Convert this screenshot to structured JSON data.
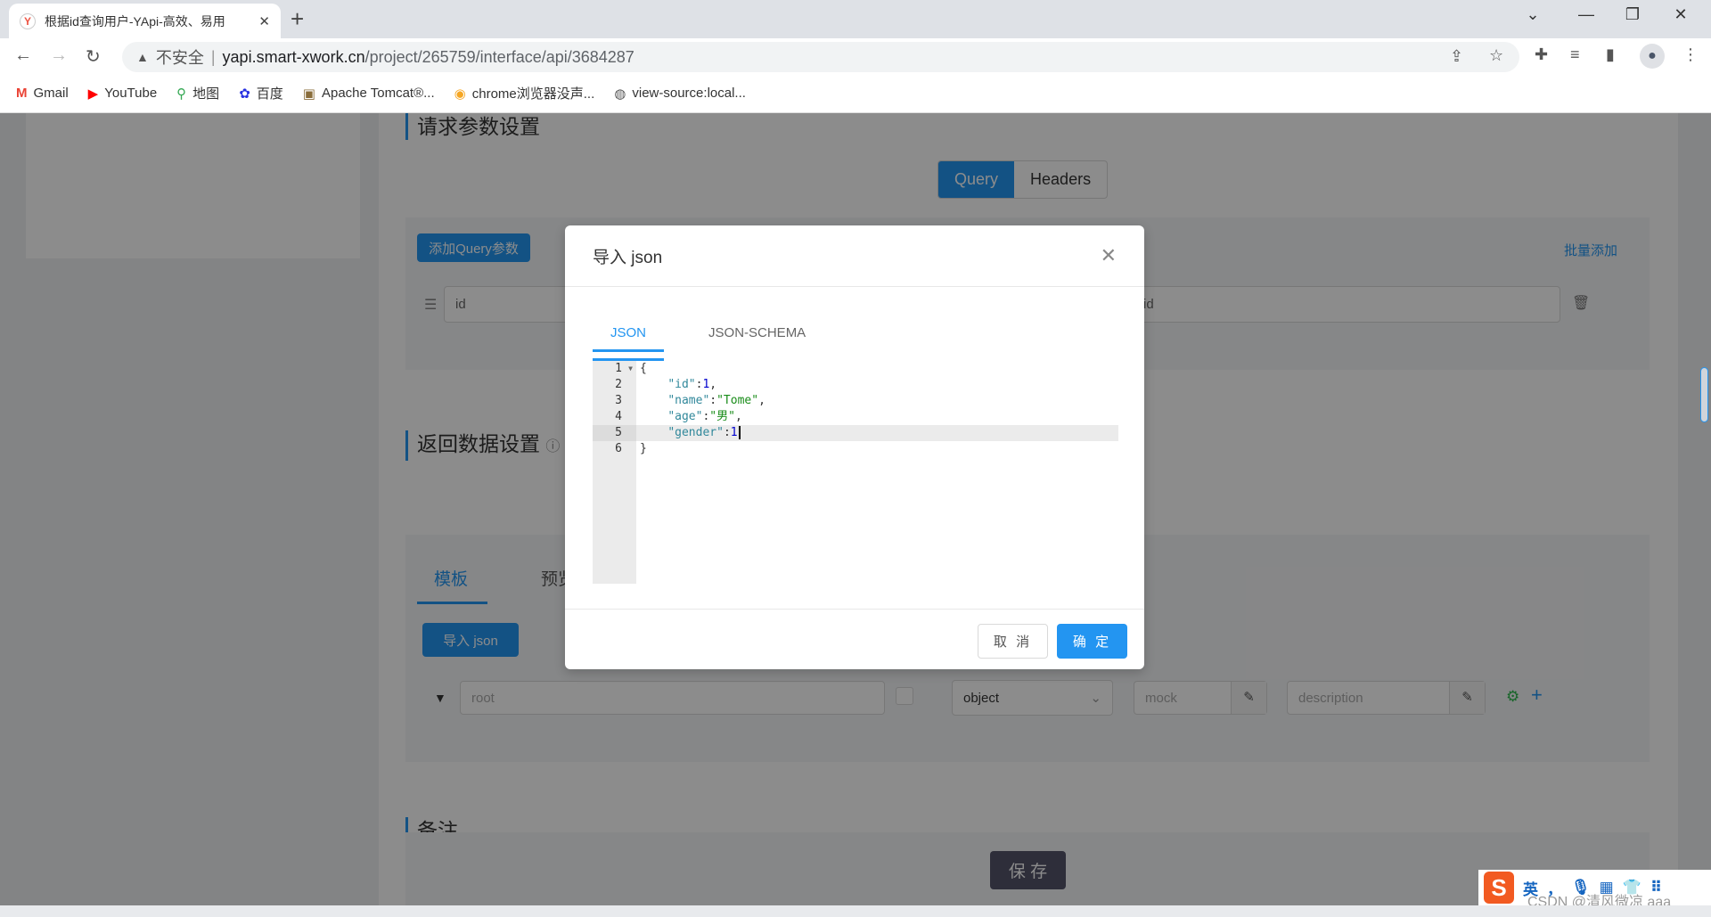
{
  "browser": {
    "tab_title": "根据id查询用户-YApi-高效、易用",
    "url_warning": "不安全",
    "url_host": "yapi.smart-xwork.cn",
    "url_path": "/project/265759/interface/api/3684287",
    "bookmarks": [
      {
        "label": "Gmail",
        "icon": "gmail-icon",
        "color": "#ea4335"
      },
      {
        "label": "YouTube",
        "icon": "youtube-icon",
        "color": "#ff0000"
      },
      {
        "label": "地图",
        "icon": "maps-icon",
        "color": "#34a853"
      },
      {
        "label": "百度",
        "icon": "baidu-icon",
        "color": "#2932e1"
      },
      {
        "label": "Apache Tomcat®...",
        "icon": "tomcat-icon",
        "color": "#8a6d3b"
      },
      {
        "label": "chrome浏览器没声...",
        "icon": "chrome-help-icon",
        "color": "#f5a623"
      },
      {
        "label": "view-source:local...",
        "icon": "globe-icon",
        "color": "#555"
      }
    ]
  },
  "page": {
    "request_section_title": "请求参数设置",
    "seg_tabs": [
      "Query",
      "Headers"
    ],
    "add_query_button": "添加Query参数",
    "bulk_add_link": "批量添加",
    "query_row": {
      "name": "id",
      "desc": "id"
    },
    "response_section_title": "返回数据设置",
    "response_tabs": [
      "模板",
      "预览"
    ],
    "import_json_button": "导入 json",
    "schema_row": {
      "name_placeholder": "root",
      "type": "object",
      "mock_placeholder": "mock",
      "desc_placeholder": "description"
    },
    "remark_section_title": "备注",
    "save_button": "保 存"
  },
  "modal": {
    "title": "导入 json",
    "tabs": [
      "JSON",
      "JSON-SCHEMA"
    ],
    "active_tab": "JSON",
    "code_lines": [
      [
        [
          "p",
          "{"
        ]
      ],
      [
        [
          "p",
          "    "
        ],
        [
          "k",
          "\"id\""
        ],
        [
          "p",
          ":"
        ],
        [
          "n",
          "1"
        ],
        [
          "p",
          ","
        ]
      ],
      [
        [
          "p",
          "    "
        ],
        [
          "k",
          "\"name\""
        ],
        [
          "p",
          ":"
        ],
        [
          "s",
          "\"Tome\""
        ],
        [
          "p",
          ","
        ]
      ],
      [
        [
          "p",
          "    "
        ],
        [
          "k",
          "\"age\""
        ],
        [
          "p",
          ":"
        ],
        [
          "s",
          "\"男\""
        ],
        [
          "p",
          ","
        ]
      ],
      [
        [
          "p",
          "    "
        ],
        [
          "k",
          "\"gender\""
        ],
        [
          "p",
          ":"
        ],
        [
          "n",
          "1"
        ]
      ],
      [
        [
          "p",
          "}"
        ]
      ]
    ],
    "line_numbers": [
      "1",
      "2",
      "3",
      "4",
      "5",
      "6"
    ],
    "active_line": 5,
    "cancel_button": "取 消",
    "ok_button": "确 定"
  },
  "ime": {
    "lang": "英",
    "punct": "，"
  },
  "watermark": "CSDN @清风微凉 aaa",
  "colors": {
    "accent": "#2395f1",
    "overlay": "rgba(0,0,0,0.45)"
  }
}
